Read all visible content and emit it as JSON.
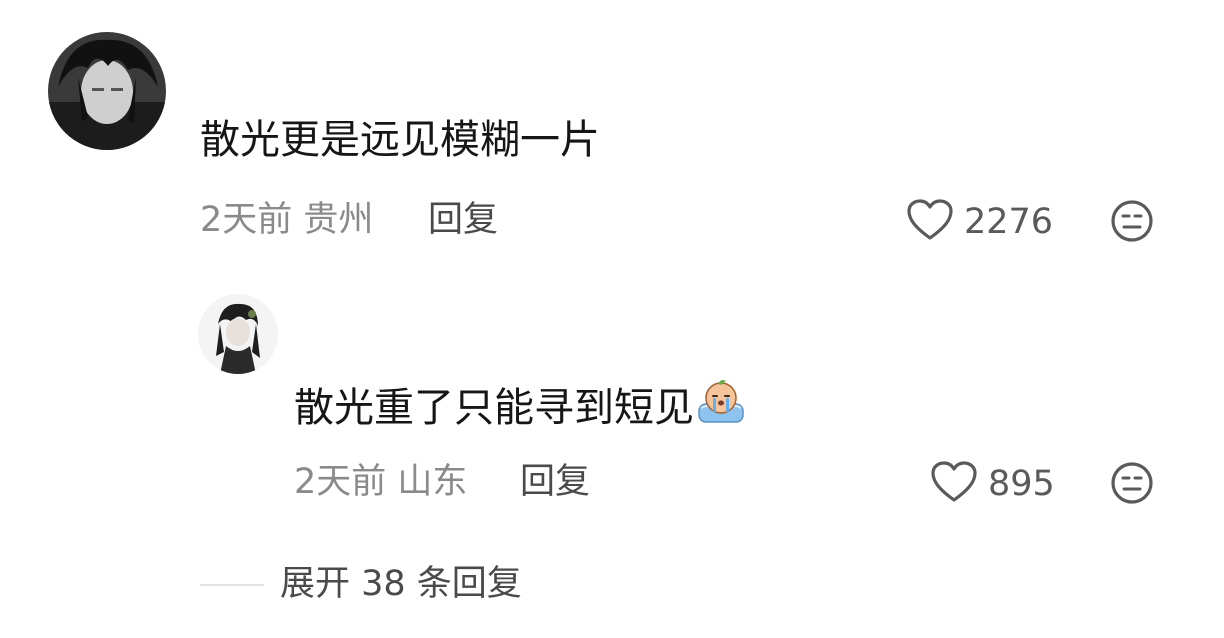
{
  "comment": {
    "avatar_icon": "user-avatar",
    "text": "散光更是远见模糊一片",
    "meta": "2天前 贵州",
    "reply_label": "回复",
    "like_count": "2276",
    "like_icon": "heart-outline-icon",
    "dislike_icon": "meh-face-icon"
  },
  "reply": {
    "avatar_icon": "user-avatar",
    "text": "散光重了只能寻到短见",
    "emoji": "crying-emoji",
    "meta": "2天前 山东",
    "reply_label": "回复",
    "like_count": "895",
    "like_icon": "heart-outline-icon",
    "dislike_icon": "meh-face-icon"
  },
  "expand": {
    "label": "展开 38 条回复"
  },
  "colors": {
    "text_primary": "#161616",
    "text_secondary": "#8a8a8a",
    "icon": "#5a5a5a"
  }
}
